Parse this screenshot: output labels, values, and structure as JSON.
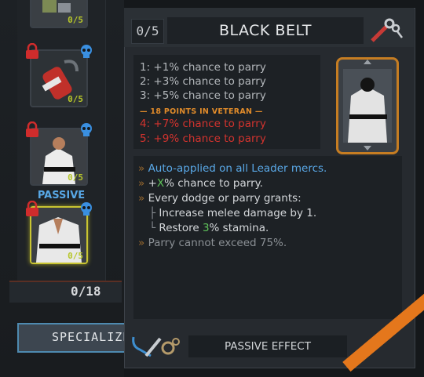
{
  "skill_column": {
    "cards": [
      {
        "count": "0/5",
        "locked": false,
        "skull": false
      },
      {
        "count": "0/5",
        "locked": true,
        "skull": true
      },
      {
        "count": "0/5",
        "locked": true,
        "skull": true
      },
      {
        "count": "0/5",
        "locked": true,
        "skull": true,
        "selected": true
      }
    ],
    "passive_label": "PASSIVE",
    "points_counter": "0/18",
    "specialize_button": "SPECIALIZE"
  },
  "popup": {
    "rank": "0/5",
    "title": "BLACK BELT",
    "header_icons": [
      "wrench-icon",
      "key-icon"
    ],
    "ranks": [
      {
        "text": "1: +1% chance to parry",
        "color": "grey"
      },
      {
        "text": "2: +3% chance to parry",
        "color": "grey"
      },
      {
        "text": "3: +5% chance to parry",
        "color": "grey"
      },
      {
        "text": "— 18 POINTS IN VETERAN —",
        "color": "orange"
      },
      {
        "text": "4: +7% chance to parry",
        "color": "red"
      },
      {
        "text": "5: +9% chance to parry",
        "color": "red"
      }
    ],
    "description": {
      "auto_applied": "Auto-applied on all Leader mercs.",
      "x_plus": "+",
      "x_letter": "X",
      "x_rest": "% chance to parry.",
      "dodge_parry": "Every dodge or parry grants:",
      "melee": "Increase melee damage by 1.",
      "restore_pre": "Restore ",
      "restore_num": "3",
      "restore_post": "% stamina.",
      "cap": "Parry cannot exceed 75%."
    },
    "footer_label": "PASSIVE EFFECT",
    "footer_icons": [
      "tools-icon",
      "gears-icon"
    ]
  },
  "colors": {
    "blue_text": "#5aa9e8",
    "red_text": "#d2332e",
    "orange_text": "#e08b2a",
    "count_text": "#b7c62a",
    "highlight_green": "#5fc35a",
    "selected_border": "#c8c431"
  }
}
